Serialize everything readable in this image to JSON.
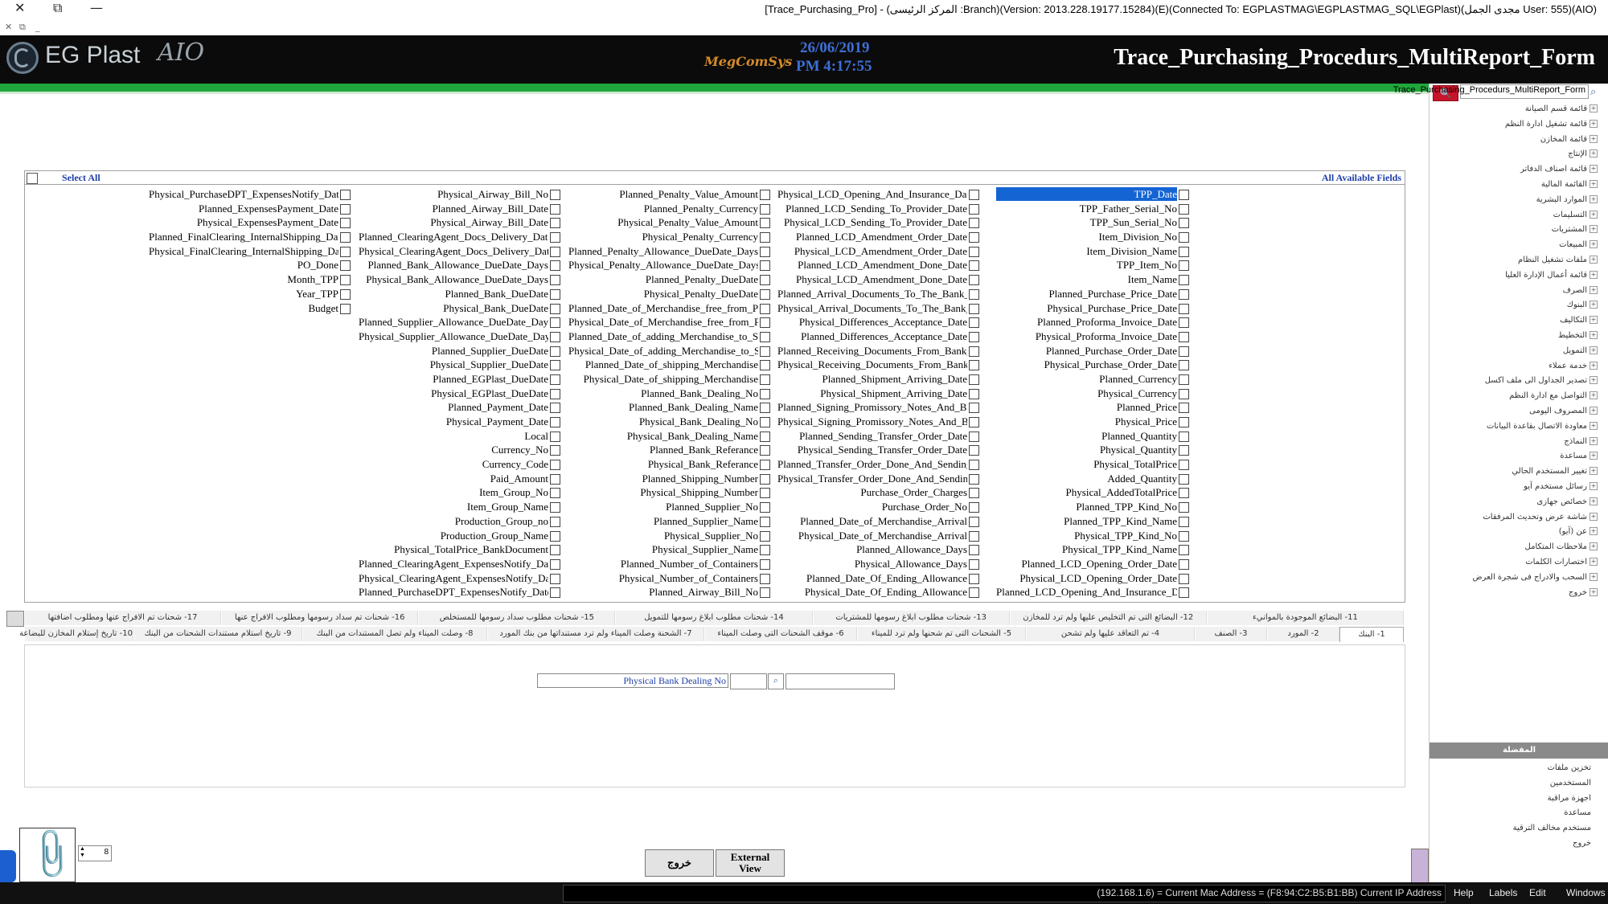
{
  "window": {
    "title": "[Trace_Purchasing_Pro] - (المركز الرئيسى :Branch)(Version: 2013.228.19177.15284)(E)(Connected To: EGPLASTMAG\\EGPLASTMAG_SQL\\EGPlast)(مجدى الجمل User: 555)(AIO)",
    "close_glyph": "✕",
    "restore_glyph": "⧉",
    "min_glyph": "—",
    "sub_close_glyph": "✕",
    "sub_restore_glyph": "⧉",
    "sub_min_glyph": "_"
  },
  "header": {
    "logo_text": "EG Plast",
    "logo_sub": "AIO",
    "brand": "MegComSys",
    "date": "26/06/2019",
    "time": "PM 4:17:55",
    "form_title": "Trace_Purchasing_Procedurs_MultiReport_Form"
  },
  "side": {
    "search_button_glyph": "🔍",
    "search_value": "Trace_Purchasing_Procedurs_MultiReport_Form",
    "search_icon": "⌕",
    "tree": [
      "قائمة قسم الصيانة",
      "قائمة تشغيل ادارة النظم",
      "قائمة المخازن",
      "الإنتاج",
      "قائمة اصناف الدفاتر",
      "القائمة المالية",
      "الموارد البشرية",
      "التسليمات",
      "المشتريات",
      "المبيعات",
      "ملفات تشغيل النظام",
      "قائمة أعمال الإدارة العليا",
      "الصرف",
      "البنوك",
      "التكاليف",
      "التخطيط",
      "التمويل",
      "خدمة عملاء",
      "تصدير الجداول الى ملف اكسل",
      "التواصل مع ادارة النظم",
      "المصروف اليومى",
      "معاودة الاتصال بقاعدة البيانات",
      "النماذج",
      "مساعدة",
      "تغيير المستخدم الحالي",
      "رسائل مستخدم آيو",
      "خصائص جهازى",
      "شاشة عرض وتحديث المرفقات",
      "عن (آيو)",
      "ملاحظات المتكامل",
      "اختصارات الكلمات",
      "السحب والادراج فى شجرة العرض",
      "خروج"
    ],
    "section_title": "المفضلة",
    "favorites": [
      "تخزين ملفات",
      "المستخدمين",
      "اجهزة مراقبة",
      "مساعدة",
      "مستخدم مخالف الترقية",
      "خروج"
    ]
  },
  "fields_panel": {
    "select_all_label": "Select All",
    "all_fields_label": "All Available Fields",
    "columns": [
      [
        "TPP_Date",
        "TPP_Father_Serial_No",
        "TPP_Sun_Serial_No",
        "Item_Division_No",
        "Item_Division_Name",
        "TPP_Item_No",
        "Item_Name",
        "Planned_Purchase_Price_Date",
        "Physical_Purchase_Price_Date",
        "Planned_Proforma_Invoice_Date",
        "Physical_Proforma_Invoice_Date",
        "Planned_Purchase_Order_Date",
        "Physical_Purchase_Order_Date",
        "Planned_Currency",
        "Physical_Currency",
        "Planned_Price",
        "Physical_Price",
        "Planned_Quantity",
        "Physical_Quantity",
        "Physical_TotalPrice",
        "Added_Quantity",
        "Physical_AddedTotalPrice",
        "Planned_TPP_Kind_No",
        "Planned_TPP_Kind_Name",
        "Physical_TPP_Kind_No",
        "Physical_TPP_Kind_Name",
        "Planned_LCD_Opening_Order_Date",
        "Physical_LCD_Opening_Order_Date",
        "Planned_LCD_Opening_And_Insurance_Date"
      ],
      [
        "Physical_LCD_Opening_And_Insurance_Date",
        "Planned_LCD_Sending_To_Provider_Date",
        "Physical_LCD_Sending_To_Provider_Date",
        "Planned_LCD_Amendment_Order_Date",
        "Physical_LCD_Amendment_Order_Date",
        "Planned_LCD_Amendment_Done_Date",
        "Physical_LCD_Amendment_Done_Date",
        "Planned_Arrival_Documents_To_The_Bank_Date",
        "Physical_Arrival_Documents_To_The_Bank_Date",
        "Physical_Differences_Acceptance_Date",
        "Planned_Differences_Acceptance_Date",
        "Planned_Receiving_Documents_From_Bank_Date",
        "Physical_Receiving_Documents_From_Bank_Date",
        "Planned_Shipment_Arriving_Date",
        "Physical_Shipment_Arriving_Date",
        "Planned_Signing_Promissory_Notes_And_Bills_Date",
        "Physical_Signing_Promissory_Notes_And_Bills_Date",
        "Planned_Sending_Transfer_Order_Date",
        "Physical_Sending_Transfer_Order_Date",
        "Planned_Transfer_Order_Done_And_Sending_Swift_Date",
        "Physical_Transfer_Order_Done_And_Sending_Swift_Date",
        "Purchase_Order_Charges",
        "Purchase_Order_No",
        "Planned_Date_of_Merchandise_Arrival",
        "Physical_Date_of_Merchandise_Arrival",
        "Planned_Allowance_Days",
        "Physical_Allowance_Days",
        "Planned_Date_Of_Ending_Allowance",
        "Physical_Date_Of_Ending_Allowance"
      ],
      [
        "Planned_Penalty_Value_Amount",
        "Planned_Penalty_Currency",
        "Physical_Penalty_Value_Amount",
        "Physical_Penalty_Currency",
        "Planned_Penalty_Allowance_DueDate_Days",
        "Physical_Penalty_Allowance_DueDate_Days",
        "Planned_Penalty_DueDate",
        "Physical_Penalty_DueDate",
        "Planned_Date_of_Merchandise_free_from_Port",
        "Physical_Date_of_Merchandise_free_from_Port",
        "Planned_Date_of_adding_Merchandise_to_Stores",
        "Physical_Date_of_adding_Merchandise_to_Stores",
        "Planned_Date_of_shipping_Merchandise",
        "Physical_Date_of_shipping_Merchandise",
        "Planned_Bank_Dealing_No",
        "Planned_Bank_Dealing_Name",
        "Physical_Bank_Dealing_No",
        "Physical_Bank_Dealing_Name",
        "Planned_Bank_Referance",
        "Physical_Bank_Referance",
        "Planned_Shipping_Number",
        "Physical_Shipping_Number",
        "Planned_Supplier_No",
        "Planned_Supplier_Name",
        "Physical_Supplier_No",
        "Physical_Supplier_Name",
        "Planned_Number_of_Containers",
        "Physical_Number_of_Containers",
        "Planned_Airway_Bill_No"
      ],
      [
        "Physical_Airway_Bill_No",
        "Planned_Airway_Bill_Date",
        "Physical_Airway_Bill_Date",
        "Planned_ClearingAgent_Docs_Delivery_Date",
        "Physical_ClearingAgent_Docs_Delivery_Date",
        "Planned_Bank_Allowance_DueDate_Days",
        "Physical_Bank_Allowance_DueDate_Days",
        "Planned_Bank_DueDate",
        "Physical_Bank_DueDate",
        "Planned_Supplier_Allowance_DueDate_Days",
        "Physical_Supplier_Allowance_DueDate_Days",
        "Planned_Supplier_DueDate",
        "Physical_Supplier_DueDate",
        "Planned_EGPlast_DueDate",
        "Physical_EGPlast_DueDate",
        "Planned_Payment_Date",
        "Physical_Payment_Date",
        "Local",
        "Currency_No",
        "Currency_Code",
        "Paid_Amount",
        "Item_Group_No",
        "Item_Group_Name",
        "Production_Group_no",
        "Production_Group_Name",
        "Physical_TotalPrice_BankDocument",
        "Planned_ClearingAgent_ExpensesNotify_Date",
        "Physical_ClearingAgent_ExpensesNotify_Date",
        "Planned_PurchaseDPT_ExpensesNotify_Date"
      ],
      [
        "Physical_PurchaseDPT_ExpensesNotify_Date",
        "Planned_ExpensesPayment_Date",
        "Physical_ExpensesPayment_Date",
        "Planned_FinalClearing_InternalShipping_Date",
        "Physical_FinalClearing_InternalShipping_Date",
        "PO_Done",
        "Month_TPP",
        "Year_TPP",
        "Budget"
      ]
    ]
  },
  "tabs": {
    "row1": [
      "11- البضائع الموجودة بالموانيء",
      "12- البضائع التى تم التخليص عليها ولم ترد للمخازن",
      "13- شحنات مطلوب ابلاغ رسومها للمشتريات",
      "14- شحنات مطلوب ابلاغ رسومها للتمويل",
      "15- شحنات مطلوب سداد رسومها للمستخلص",
      "16- شحنات تم سداد رسومها ومطلوب الافراج عنها",
      "17- شحنات تم الافراج عنها ومطلوب اضافتها"
    ],
    "row2": [
      "1- البنك",
      "2- المورد",
      "3- الصنف",
      "4- تم التعاقد عليها ولم تشحن",
      "5- الشحنات التى تم شحنها ولم ترد للميناء",
      "6- موقف الشحنات التى وصلت الميناء",
      "7- الشحنة وصلت الميناء ولم ترد مستنداتها من بنك المورد",
      "8- وصلت الميناء ولم تصل المستندات من البنك",
      "9- تاريخ استلام مستندات الشحنات من البنك",
      "10- تاريخ إستلام المخازن للبضاعة"
    ]
  },
  "criteria": {
    "field": "Physical Bank Dealing No",
    "op": "",
    "value": "",
    "search_glyph": "⌕"
  },
  "bottom": {
    "clip_glyph": "📎",
    "spin_value": "8",
    "spin_up": "▲",
    "spin_down": "▼",
    "exit_label": "خروج",
    "external_view_line1": "External",
    "external_view_line2": "View"
  },
  "status": {
    "text": "(192.168.1.6) = Current Mac Address = (F8:94:C2:B5:B1:BB) Current IP Address",
    "menus": [
      "Help",
      "Labels",
      "Edit",
      "Windows"
    ]
  }
}
